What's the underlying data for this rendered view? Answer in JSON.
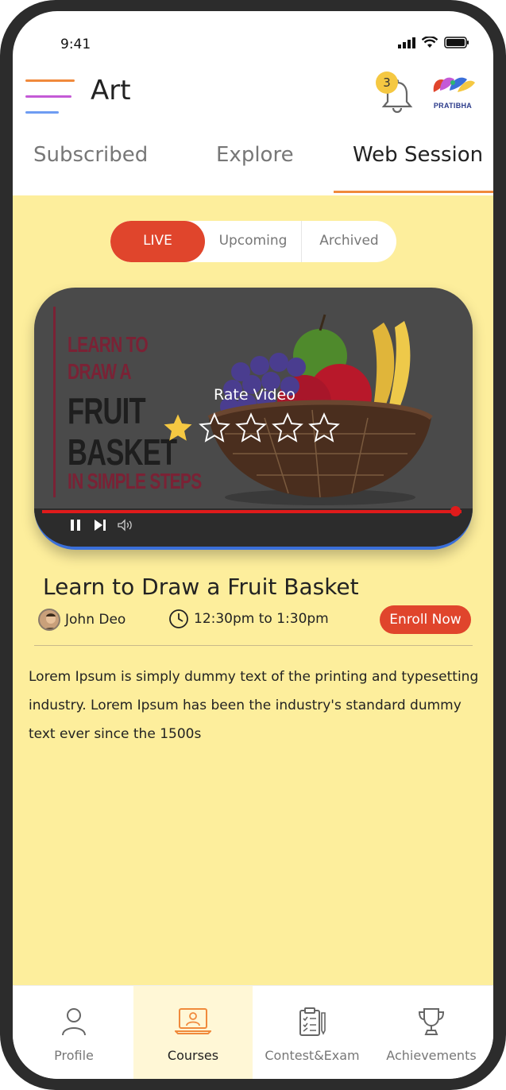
{
  "status_bar": {
    "time": "9:41"
  },
  "header": {
    "title": "Art",
    "notification_count": "3",
    "logo_text": "PRATIBHA"
  },
  "tabs": [
    {
      "label": "Subscribed",
      "active": false
    },
    {
      "label": "Explore",
      "active": false
    },
    {
      "label": "Web Session",
      "active": true
    }
  ],
  "segment": {
    "live": "LIVE",
    "upcoming": "Upcoming",
    "archived": "Archived",
    "selected": "LIVE"
  },
  "video": {
    "thumb_lines": [
      "LEARN TO",
      "DRAW A",
      "FRUIT",
      "BASKET",
      "IN SIMPLE STEPS"
    ],
    "rate_label": "Rate Video",
    "rating": 1,
    "max_rating": 5
  },
  "course": {
    "title": "Learn to  Draw a Fruit Basket",
    "author": "John Deo",
    "time": "12:30pm to 1:30pm",
    "enroll_label": "Enroll Now",
    "description": "Lorem Ipsum is simply dummy text of the printing and typesetting industry. Lorem Ipsum has been the industry's standard dummy text ever since the 1500s"
  },
  "bottom_nav": [
    {
      "label": "Profile",
      "icon": "person-icon",
      "active": false
    },
    {
      "label": "Courses",
      "icon": "laptop-user-icon",
      "active": true
    },
    {
      "label": "Contest&Exam",
      "icon": "clipboard-checklist-icon",
      "active": false
    },
    {
      "label": "Achievements",
      "icon": "trophy-icon",
      "active": false
    }
  ],
  "colors": {
    "accent": "#e0452c",
    "background": "#fdee9c",
    "tab_underline": "#f08a3c",
    "badge": "#f5c842",
    "star": "#f5c842"
  }
}
